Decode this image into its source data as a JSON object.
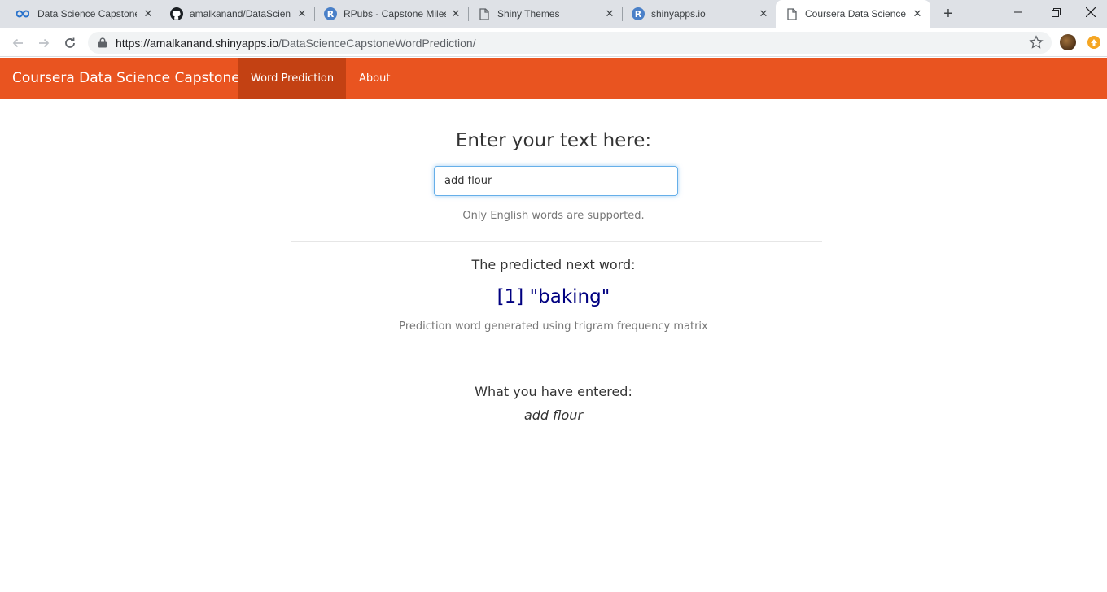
{
  "browser": {
    "tabs": [
      {
        "title": "Data Science Capstone",
        "icon": "coursera-infinity-icon"
      },
      {
        "title": "amalkanand/DataScien",
        "icon": "github-icon"
      },
      {
        "title": "RPubs - Capstone Miles",
        "icon": "rstudio-r-icon"
      },
      {
        "title": "Shiny Themes",
        "icon": "page-icon"
      },
      {
        "title": "shinyapps.io",
        "icon": "rstudio-r-icon"
      },
      {
        "title": "Coursera Data Science C",
        "icon": "page-icon"
      }
    ],
    "url_host": "https://amalkanand.shinyapps.io",
    "url_path": "/DataScienceCapstoneWordPrediction/"
  },
  "navbar": {
    "brand": "Coursera Data Science Capstone",
    "items": [
      {
        "label": "Word Prediction"
      },
      {
        "label": "About"
      }
    ],
    "color": "#e95420",
    "active_color": "#c34113"
  },
  "main": {
    "heading": "Enter your text here:",
    "input_value": "add flour",
    "help_text": "Only English words are supported.",
    "predicted_heading": "The predicted next word:",
    "predicted_word": "[1] \"baking\"",
    "prediction_note": "Prediction word generated using trigram frequency matrix",
    "entered_heading": "What you have entered:",
    "entered_text": "add flour"
  }
}
